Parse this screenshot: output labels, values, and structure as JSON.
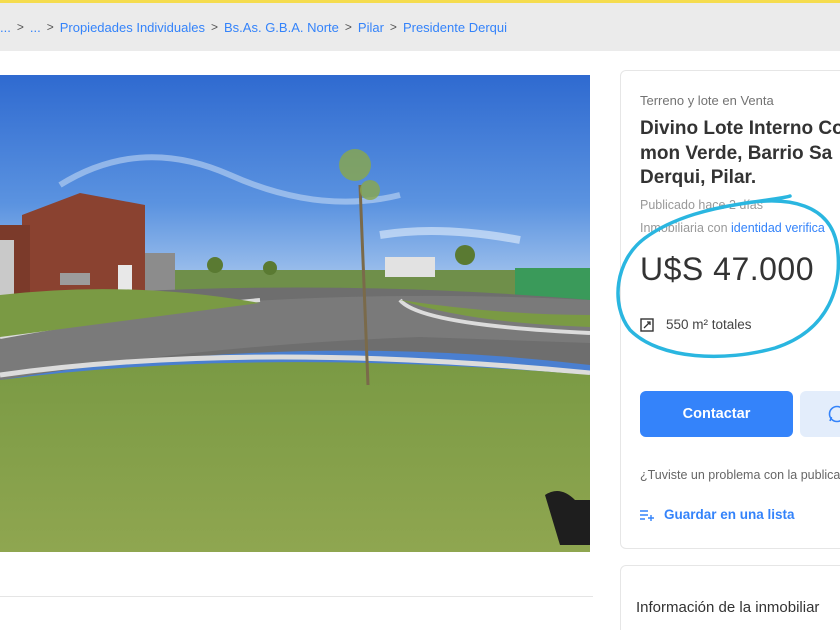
{
  "breadcrumb": [
    {
      "label": "..."
    },
    {
      "label": "..."
    },
    {
      "label": "Propiedades Individuales"
    },
    {
      "label": "Bs.As. G.B.A. Norte"
    },
    {
      "label": "Pilar"
    },
    {
      "label": "Presidente Derqui"
    }
  ],
  "listing": {
    "subtitle": "Terreno y lote en Venta",
    "title_lines": [
      "Divino Lote Interno Co",
      "mon Verde, Barrio Sa",
      "Derqui, Pilar."
    ],
    "published": "Publicado hace 2 días",
    "agency_prefix": "Inmobiliaria con ",
    "agency_link": "identidad verifica",
    "price": "U$S 47.000",
    "area_value": "550 m² totales",
    "contact_button": "Contactar",
    "problem_text": "¿Tuviste un problema con la publicación",
    "save_label": "Guardar en una lista"
  },
  "agency_section": {
    "title": "Información de la inmobiliar"
  },
  "colors": {
    "accent": "#3483fa",
    "top_bar": "#f5dc4e",
    "breadcrumb_bg": "#ebebeb",
    "circle_annotation": "#2ab6e0"
  },
  "icons": {
    "area": "area-icon",
    "save": "list-add-icon",
    "whatsapp": "whatsapp-icon"
  }
}
